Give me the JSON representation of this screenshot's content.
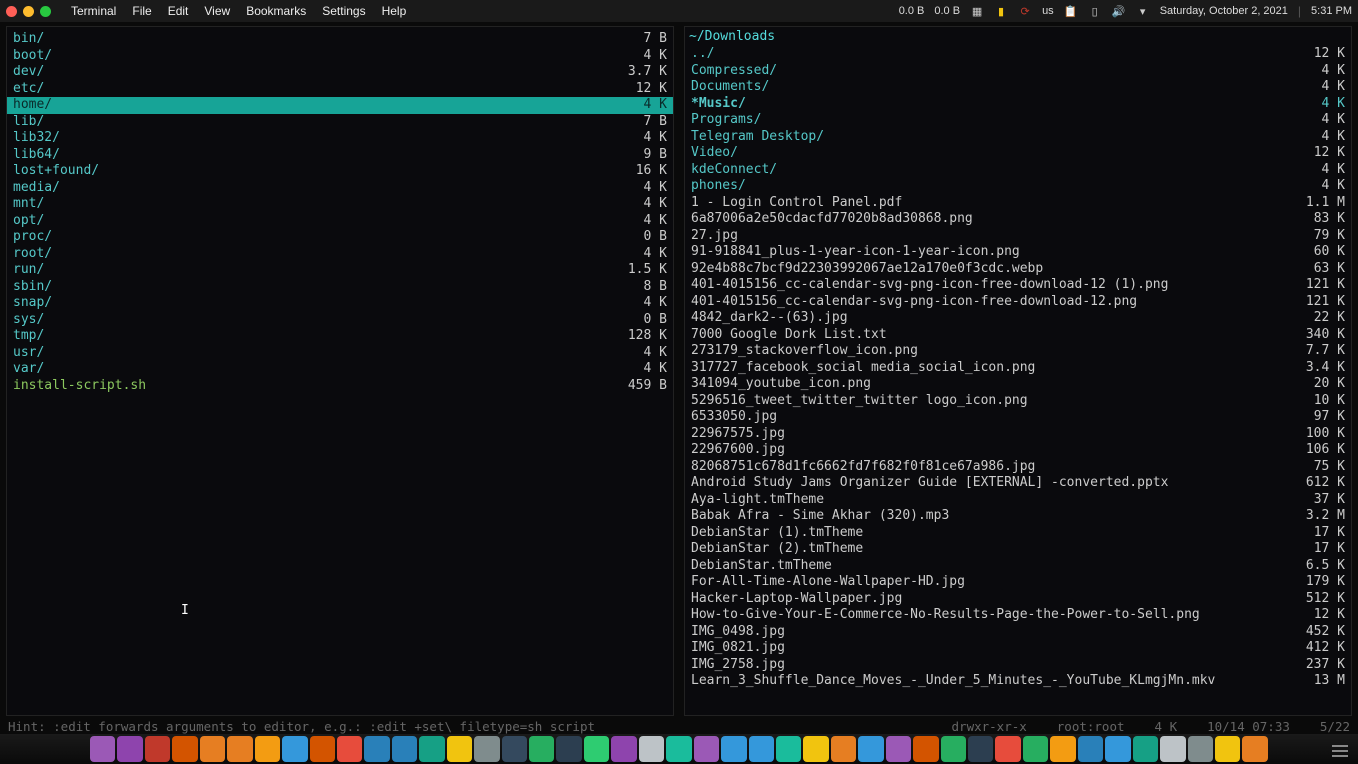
{
  "menubar": {
    "app": "Terminal",
    "items": [
      "File",
      "Edit",
      "View",
      "Bookmarks",
      "Settings",
      "Help"
    ],
    "net_down": "0.0 B",
    "net_up": "0.0 B",
    "kb": "us",
    "date": "Saturday, October 2, 2021",
    "time": "5:31 PM"
  },
  "left_pane": {
    "entries": [
      {
        "name": "bin/",
        "size": "7 B",
        "cls": "dir"
      },
      {
        "name": "boot/",
        "size": "4 K",
        "cls": "dir"
      },
      {
        "name": "dev/",
        "size": "3.7 K",
        "cls": "dir"
      },
      {
        "name": "etc/",
        "size": "12 K",
        "cls": "dir"
      },
      {
        "name": "home/",
        "size": "4 K",
        "cls": "dir",
        "selected": true
      },
      {
        "name": "lib/",
        "size": "7 B",
        "cls": "dir"
      },
      {
        "name": "lib32/",
        "size": "4 K",
        "cls": "dir"
      },
      {
        "name": "lib64/",
        "size": "9 B",
        "cls": "dir"
      },
      {
        "name": "lost+found/",
        "size": "16 K",
        "cls": "dir"
      },
      {
        "name": "media/",
        "size": "4 K",
        "cls": "dir"
      },
      {
        "name": "mnt/",
        "size": "4 K",
        "cls": "dir"
      },
      {
        "name": "opt/",
        "size": "4 K",
        "cls": "dir"
      },
      {
        "name": "proc/",
        "size": "0 B",
        "cls": "dir"
      },
      {
        "name": "root/",
        "size": "4 K",
        "cls": "dir"
      },
      {
        "name": "run/",
        "size": "1.5 K",
        "cls": "dir"
      },
      {
        "name": "sbin/",
        "size": "8 B",
        "cls": "dir"
      },
      {
        "name": "snap/",
        "size": "4 K",
        "cls": "dir"
      },
      {
        "name": "sys/",
        "size": "0 B",
        "cls": "dir"
      },
      {
        "name": "tmp/",
        "size": "128 K",
        "cls": "dir"
      },
      {
        "name": "usr/",
        "size": "4 K",
        "cls": "dir"
      },
      {
        "name": "var/",
        "size": "4 K",
        "cls": "dir"
      },
      {
        "name": "install-script.sh",
        "size": "459 B",
        "cls": "exec"
      }
    ]
  },
  "right_pane": {
    "path": "~/Downloads",
    "entries": [
      {
        "name": "../",
        "size": "12 K",
        "cls": "dir"
      },
      {
        "name": "Compressed/",
        "size": "4 K",
        "cls": "dir"
      },
      {
        "name": "Documents/",
        "size": "4 K",
        "cls": "dir"
      },
      {
        "name": "Music/",
        "size": "4 K",
        "cls": "dir",
        "marked": true
      },
      {
        "name": "Programs/",
        "size": "4 K",
        "cls": "dir"
      },
      {
        "name": "Telegram Desktop/",
        "size": "4 K",
        "cls": "dir"
      },
      {
        "name": "Video/",
        "size": "12 K",
        "cls": "dir"
      },
      {
        "name": "kdeConnect/",
        "size": "4 K",
        "cls": "dir"
      },
      {
        "name": "phones/",
        "size": "4 K",
        "cls": "dir"
      },
      {
        "name": "1 - Login Control Panel.pdf",
        "size": "1.1 M",
        "cls": "file"
      },
      {
        "name": "6a87006a2e50cdacfd77020b8ad30868.png",
        "size": "83 K",
        "cls": "file"
      },
      {
        "name": "27.jpg",
        "size": "79 K",
        "cls": "file"
      },
      {
        "name": "91-918841_plus-1-year-icon-1-year-icon.png",
        "size": "60 K",
        "cls": "file"
      },
      {
        "name": "92e4b88c7bcf9d22303992067ae12a170e0f3cdc.webp",
        "size": "63 K",
        "cls": "file"
      },
      {
        "name": "401-4015156_cc-calendar-svg-png-icon-free-download-12 (1).png",
        "size": "121 K",
        "cls": "file"
      },
      {
        "name": "401-4015156_cc-calendar-svg-png-icon-free-download-12.png",
        "size": "121 K",
        "cls": "file"
      },
      {
        "name": "4842_dark2--(63).jpg",
        "size": "22 K",
        "cls": "file"
      },
      {
        "name": "7000 Google Dork List.txt",
        "size": "340 K",
        "cls": "file"
      },
      {
        "name": "273179_stackoverflow_icon.png",
        "size": "7.7 K",
        "cls": "file"
      },
      {
        "name": "317727_facebook_social media_social_icon.png",
        "size": "3.4 K",
        "cls": "file"
      },
      {
        "name": "341094_youtube_icon.png",
        "size": "20 K",
        "cls": "file"
      },
      {
        "name": "5296516_tweet_twitter_twitter logo_icon.png",
        "size": "10 K",
        "cls": "file"
      },
      {
        "name": "6533050.jpg",
        "size": "97 K",
        "cls": "file"
      },
      {
        "name": "22967575.jpg",
        "size": "100 K",
        "cls": "file"
      },
      {
        "name": "22967600.jpg",
        "size": "106 K",
        "cls": "file"
      },
      {
        "name": "82068751c678d1fc6662fd7f682f0f81ce67a986.jpg",
        "size": "75 K",
        "cls": "file"
      },
      {
        "name": "Android Study Jams Organizer Guide [EXTERNAL] -converted.pptx",
        "size": "612 K",
        "cls": "file"
      },
      {
        "name": "Aya-light.tmTheme",
        "size": "37 K",
        "cls": "file"
      },
      {
        "name": "Babak Afra - Sime Akhar (320).mp3",
        "size": "3.2 M",
        "cls": "file"
      },
      {
        "name": "DebianStar (1).tmTheme",
        "size": "17 K",
        "cls": "file"
      },
      {
        "name": "DebianStar (2).tmTheme",
        "size": "17 K",
        "cls": "file"
      },
      {
        "name": "DebianStar.tmTheme",
        "size": "6.5 K",
        "cls": "file"
      },
      {
        "name": "For-All-Time-Alone-Wallpaper-HD.jpg",
        "size": "179 K",
        "cls": "file"
      },
      {
        "name": "Hacker-Laptop-Wallpaper.jpg",
        "size": "512 K",
        "cls": "file"
      },
      {
        "name": "How-to-Give-Your-E-Commerce-No-Results-Page-the-Power-to-Sell.png",
        "size": "12 K",
        "cls": "file"
      },
      {
        "name": "IMG_0498.jpg",
        "size": "452 K",
        "cls": "file"
      },
      {
        "name": "IMG_0821.jpg",
        "size": "412 K",
        "cls": "file"
      },
      {
        "name": "IMG_2758.jpg",
        "size": "237 K",
        "cls": "file"
      },
      {
        "name": "Learn_3_Shuffle_Dance_Moves_-_Under_5_Minutes_-_YouTube_KLmgjMn.mkv",
        "size": "13 M",
        "cls": "file"
      }
    ]
  },
  "status": {
    "hint": "Hint: :edit forwards arguments to editor, e.g.: :edit +set\\ filetype=sh script",
    "perm": "drwxr-xr-x",
    "owner": "root:root",
    "size": "4 K",
    "date": "10/14 07:33",
    "pos": "5/22"
  },
  "dock_colors": [
    "#9b59b6",
    "#8e44ad",
    "#c0392b",
    "#d35400",
    "#e67e22",
    "#e67e22",
    "#f39c12",
    "#3498db",
    "#d35400",
    "#e74c3c",
    "#2980b9",
    "#2980b9",
    "#16a085",
    "#f1c40f",
    "#7f8c8d",
    "#34495e",
    "#27ae60",
    "#2c3e50",
    "#2ecc71",
    "#8e44ad",
    "#bdc3c7",
    "#1abc9c",
    "#9b59b6",
    "#3498db",
    "#3498db",
    "#1abc9c",
    "#f1c40f",
    "#e67e22",
    "#3498db",
    "#9b59b6",
    "#d35400",
    "#27ae60",
    "#2c3e50",
    "#e74c3c",
    "#27ae60",
    "#f39c12",
    "#2980b9",
    "#3498db",
    "#16a085",
    "#bdc3c7",
    "#7f8c8d",
    "#f1c40f",
    "#e67e22"
  ]
}
